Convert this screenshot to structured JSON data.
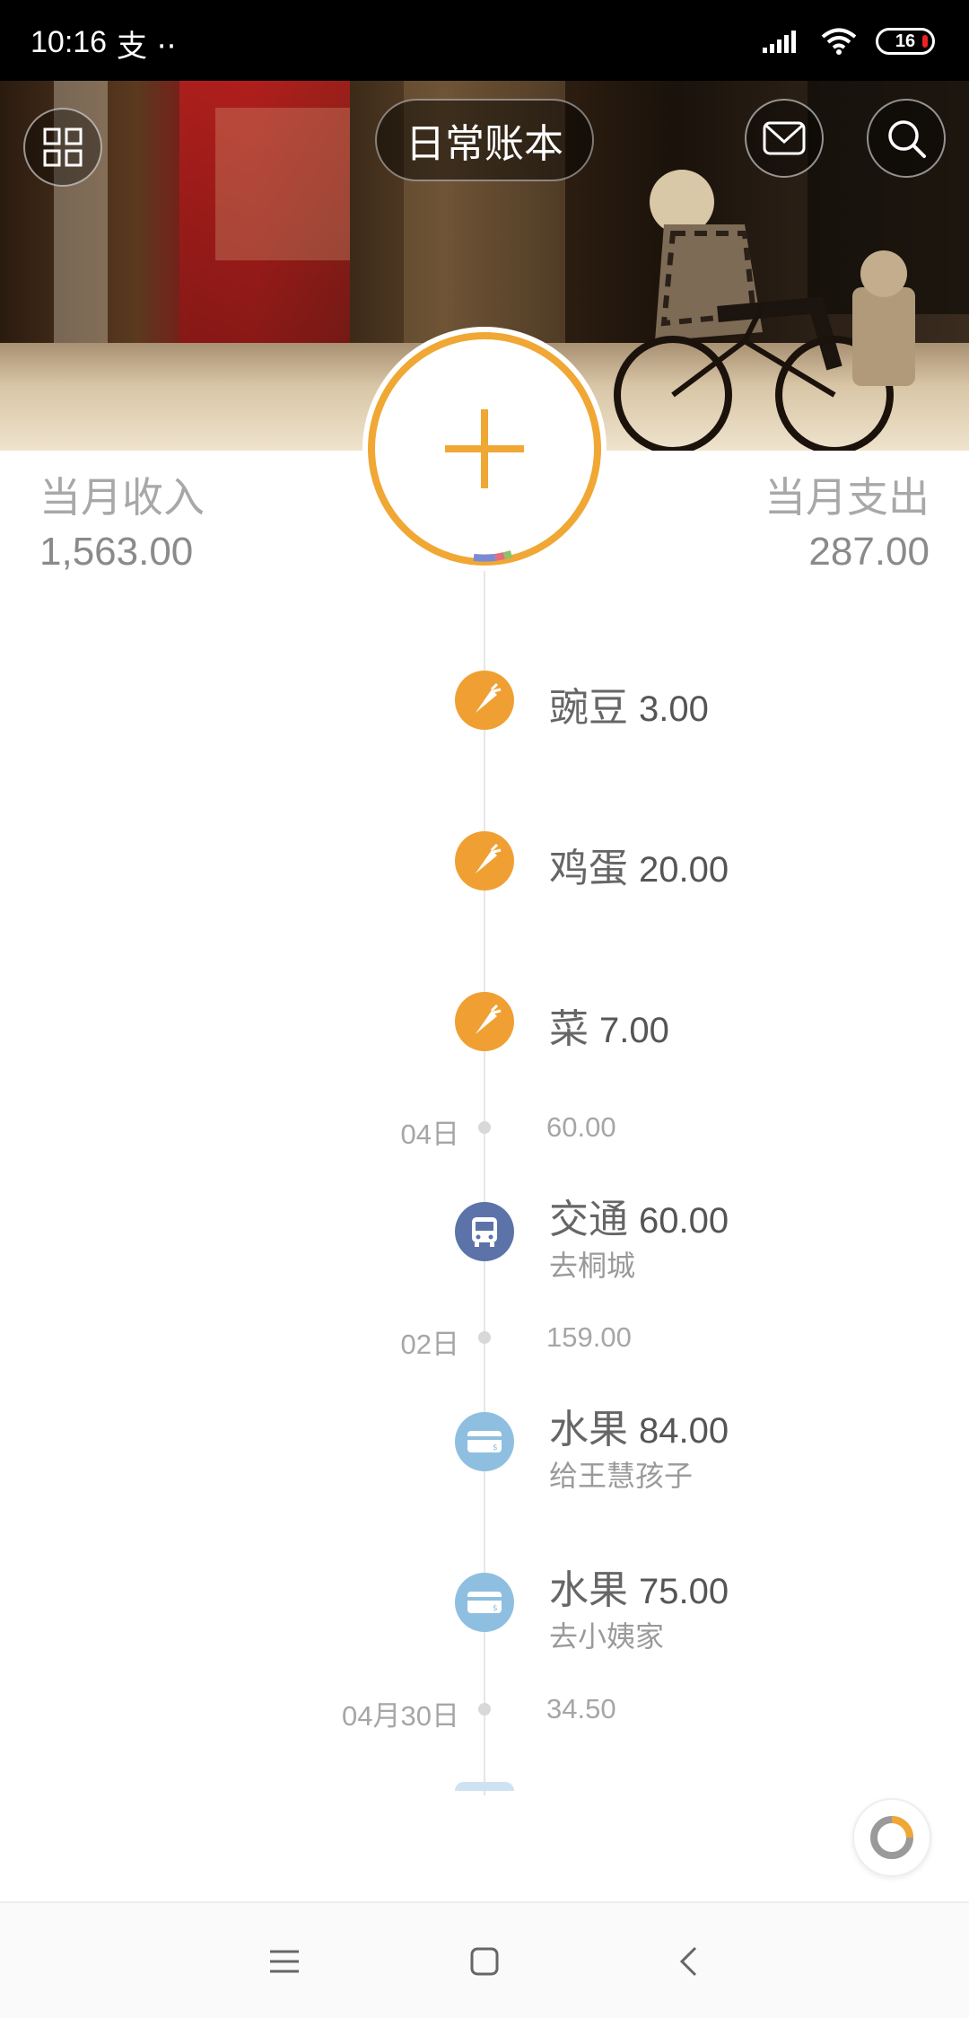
{
  "status_bar": {
    "time": "10:16",
    "left_icons": "支 ··",
    "battery": "16"
  },
  "header": {
    "book_name": "日常账本",
    "menu_icon": "grid-icon",
    "mail_icon": "mail-icon",
    "search_icon": "search-icon"
  },
  "summary": {
    "income_label": "当月收入",
    "income_value": "1,563.00",
    "expense_label": "当月支出",
    "expense_value": "287.00"
  },
  "timeline": {
    "entries": [
      {
        "title": "豌豆",
        "amount": "3.00",
        "note": "",
        "icon": "carrot-icon",
        "color": "#f0a032"
      },
      {
        "title": "鸡蛋",
        "amount": "20.00",
        "note": "",
        "icon": "carrot-icon",
        "color": "#f0a032"
      },
      {
        "title": "菜",
        "amount": "7.00",
        "note": "",
        "icon": "carrot-icon",
        "color": "#f0a032"
      },
      {
        "title": "交通",
        "amount": "60.00",
        "note": "去桐城",
        "icon": "bus-icon",
        "color": "#5b73a8"
      },
      {
        "title": "水果",
        "amount": "84.00",
        "note": "给王慧孩子",
        "icon": "card-icon",
        "color": "#8fbfe0"
      },
      {
        "title": "水果",
        "amount": "75.00",
        "note": "去小姨家",
        "icon": "card-icon",
        "color": "#8fbfe0"
      }
    ],
    "days": [
      {
        "label": "04日",
        "total": "60.00"
      },
      {
        "label": "02日",
        "total": "159.00"
      },
      {
        "label": "04月30日",
        "total": "34.50"
      }
    ]
  },
  "colors": {
    "accent": "#f0a734",
    "status_bar": "#000000"
  },
  "nav": {
    "menu_icon": "menu-icon",
    "home_icon": "home-icon",
    "back_icon": "back-icon"
  }
}
